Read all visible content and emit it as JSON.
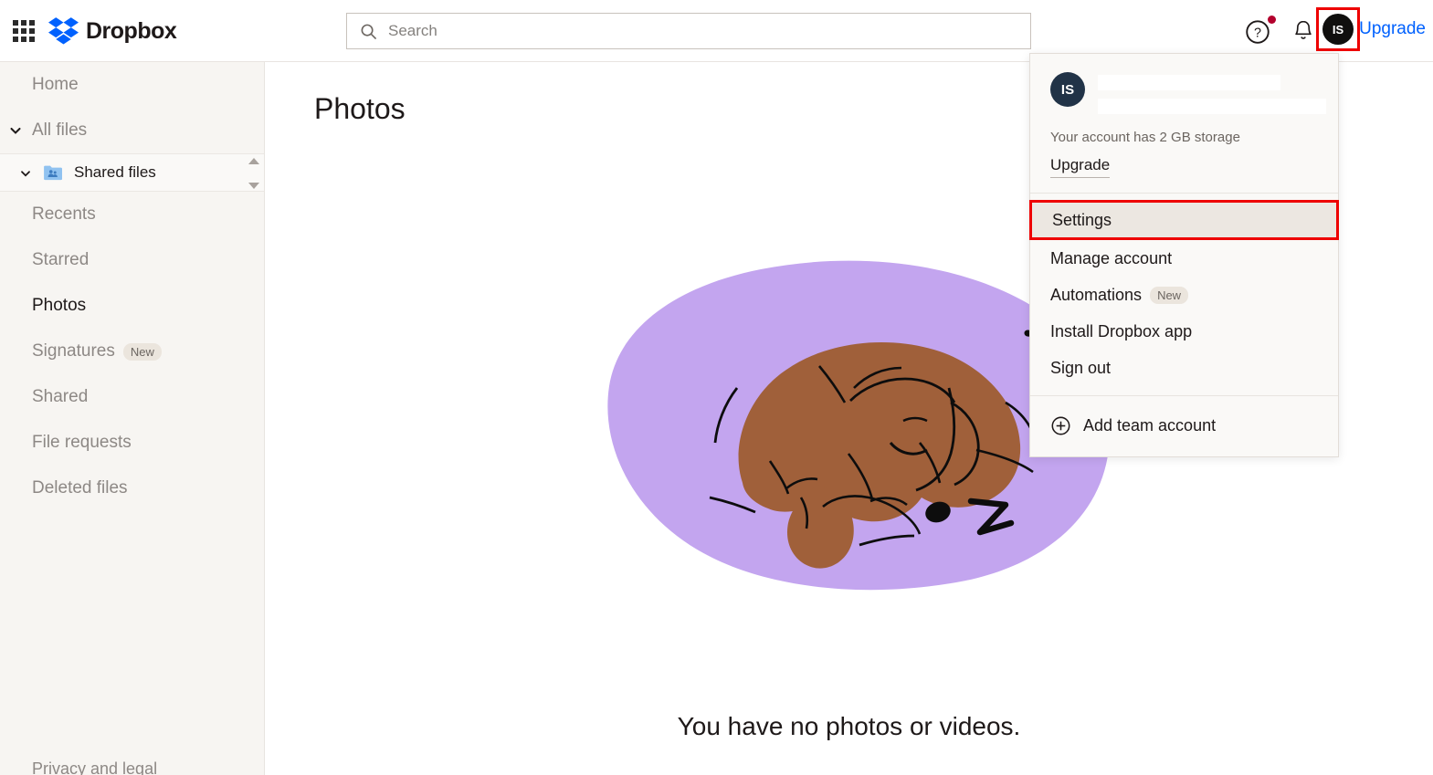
{
  "header": {
    "app_grid_icon": "app-grid-icon",
    "logo_text": "Dropbox",
    "logo_icon": "dropbox-logo-icon",
    "search": {
      "placeholder": "Search",
      "value": "",
      "icon": "search-icon"
    },
    "help_icon": "help-circle-icon",
    "notification_icon": "bell-icon",
    "avatar_initials": "IS",
    "upgrade_label": "Upgrade",
    "accent_blue": "#0061fe",
    "highlight_red": "#ee0000"
  },
  "sidebar": {
    "items": [
      {
        "label": "Home",
        "icon": null,
        "active": false,
        "expandable": false
      },
      {
        "label": "All files",
        "icon": "chevron-down-icon",
        "active": false,
        "expandable": true
      },
      {
        "label": "Recents",
        "icon": null,
        "active": false,
        "expandable": false
      },
      {
        "label": "Starred",
        "icon": null,
        "active": false,
        "expandable": false
      },
      {
        "label": "Photos",
        "icon": null,
        "active": true,
        "expandable": false
      },
      {
        "label": "Signatures",
        "icon": null,
        "active": false,
        "expandable": false,
        "badge": "New"
      },
      {
        "label": "Shared",
        "icon": null,
        "active": false,
        "expandable": false
      },
      {
        "label": "File requests",
        "icon": null,
        "active": false,
        "expandable": false
      },
      {
        "label": "Deleted files",
        "icon": null,
        "active": false,
        "expandable": false
      }
    ],
    "shared_files": {
      "label": "Shared files",
      "chevron_icon": "chevron-down-icon",
      "folder_icon": "shared-folder-icon",
      "scroll_up_icon": "scroll-up-arrow",
      "scroll_down_icon": "scroll-down-arrow"
    },
    "footer_link": "Privacy and legal",
    "background": "#f7f5f2"
  },
  "main": {
    "title": "Photos",
    "empty_state_text": "You have no photos or videos.",
    "illustration": {
      "name": "sleeping-dog-illustration",
      "blob_color": "#c3a5ef",
      "dog_color": "#a0603a",
      "stroke_color": "#0d0d0d"
    }
  },
  "account_menu": {
    "avatar_initials": "IS",
    "avatar_color": "#213347",
    "name_redacted": true,
    "email_redacted": true,
    "storage_text": "Your account has 2 GB storage",
    "upgrade_label": "Upgrade",
    "items": [
      {
        "label": "Settings",
        "highlighted": true,
        "badge": null
      },
      {
        "label": "Manage account",
        "highlighted": false,
        "badge": null
      },
      {
        "label": "Automations",
        "highlighted": false,
        "badge": "New"
      },
      {
        "label": "Install Dropbox app",
        "highlighted": false,
        "badge": null
      },
      {
        "label": "Sign out",
        "highlighted": false,
        "badge": null
      }
    ],
    "footer_item": {
      "label": "Add team account",
      "icon": "plus-circle-icon"
    }
  }
}
